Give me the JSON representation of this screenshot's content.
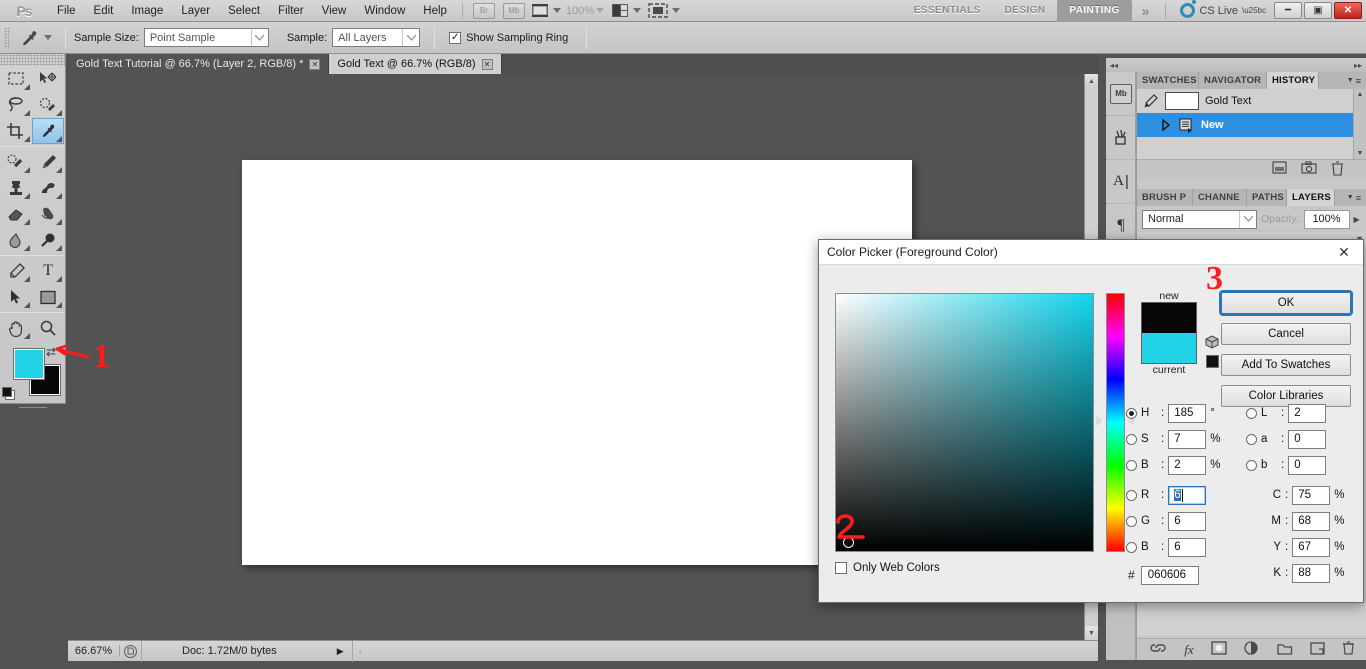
{
  "app": {
    "logo": "Ps",
    "menus": [
      "File",
      "Edit",
      "Image",
      "Layer",
      "Select",
      "Filter",
      "View",
      "Window",
      "Help"
    ],
    "bridge_button": "Br",
    "minibridge_button": "Mb",
    "zoom_level_menubar": "100%",
    "workspaces": [
      "ESSENTIALS",
      "DESIGN",
      "PAINTING"
    ],
    "workspace_active": "PAINTING",
    "workspace_more": "»",
    "cs_live": "CS Live",
    "window_buttons": {
      "minimize": "━",
      "restore": "▣",
      "close": "✕"
    }
  },
  "options_bar": {
    "tool": "eyedropper-tool",
    "sample_size_label": "Sample Size:",
    "sample_size_value": "Point Sample",
    "sample_label": "Sample:",
    "sample_value": "All Layers",
    "show_sampling_ring_label": "Show Sampling Ring",
    "show_sampling_ring_checked": true,
    "checkmark": "✓"
  },
  "document_tabs": [
    {
      "label": "Gold Text Tutorial @ 66.7% (Layer 2, RGB/8) *",
      "active": false,
      "close": "✕"
    },
    {
      "label": "Gold Text @ 66.7% (RGB/8)",
      "active": true,
      "close": "✕"
    }
  ],
  "toolbar": {
    "tools": [
      {
        "name": "rectangular-marquee-tool",
        "glyph": "⬚"
      },
      {
        "name": "move-tool",
        "glyph": "✥"
      },
      {
        "name": "lasso-tool",
        "glyph": "❦"
      },
      {
        "name": "quick-selection-tool",
        "glyph": "✒"
      },
      {
        "name": "crop-tool",
        "glyph": "⌗"
      },
      {
        "name": "eyedropper-tool",
        "glyph": "✐",
        "selected": true
      },
      {
        "name": "spot-healing-brush-tool",
        "glyph": "☙"
      },
      {
        "name": "brush-tool",
        "glyph": "✏"
      },
      {
        "name": "clone-stamp-tool",
        "glyph": "☖"
      },
      {
        "name": "history-brush-tool",
        "glyph": "✍"
      },
      {
        "name": "eraser-tool",
        "glyph": "▱"
      },
      {
        "name": "gradient-tool",
        "glyph": "◩"
      },
      {
        "name": "blur-tool",
        "glyph": "◖"
      },
      {
        "name": "dodge-tool",
        "glyph": "⚫"
      },
      {
        "name": "pen-tool",
        "glyph": "✑"
      },
      {
        "name": "horizontal-type-tool",
        "glyph": "T"
      },
      {
        "name": "path-selection-tool",
        "glyph": "➤"
      },
      {
        "name": "rectangle-tool",
        "glyph": "■"
      },
      {
        "name": "hand-tool",
        "glyph": "✋"
      },
      {
        "name": "zoom-tool",
        "glyph": "⌕"
      }
    ],
    "foreground_color": "#22d3e8",
    "background_color": "#060606",
    "swap_glyph": "⇄"
  },
  "status_bar": {
    "zoom": "66.67%",
    "doc_info": "Doc: 1.72M/0 bytes",
    "arrow": "▶",
    "left_arrow": "‹"
  },
  "history_panel": {
    "tabs": [
      "SWATCHES",
      "NAVIGATOR",
      "HISTORY"
    ],
    "active_tab": "HISTORY",
    "menu_glyph": "≡",
    "states": [
      {
        "label": "Gold Text",
        "selected": false
      },
      {
        "label": "New",
        "selected": true
      }
    ],
    "footer_icons": [
      "new-document-from-state-icon",
      "new-snapshot-icon",
      "delete-state-icon"
    ],
    "selected_color": "#2e8fe0"
  },
  "layers_panel": {
    "tabs": [
      "BRUSH P",
      "CHANNE",
      "PATHS",
      "LAYERS"
    ],
    "active_tab": "LAYERS",
    "menu_glyph": "≡",
    "blend_mode": "Normal",
    "opacity_label": "Opacity:",
    "opacity_value": "100%",
    "footer_icons": [
      "link-layers-icon",
      "layer-style-icon",
      "layer-mask-icon",
      "adjustment-layer-icon",
      "new-group-icon",
      "new-layer-icon",
      "delete-layer-icon"
    ]
  },
  "icon_rail": {
    "items": [
      "mini-bridge-icon",
      "brush-presets-icon",
      "character-icon",
      "paragraph-icon"
    ],
    "labels": [
      "Mb",
      "✁",
      "A",
      "¶"
    ],
    "collapse_left": "◂◂",
    "collapse_right": "▸▸"
  },
  "color_picker": {
    "title": "Color Picker (Foreground Color)",
    "close_glyph": "✕",
    "buttons": {
      "ok": "OK",
      "cancel": "Cancel",
      "add_to_swatches": "Add To Swatches",
      "color_libraries": "Color Libraries"
    },
    "preview": {
      "new_label": "new",
      "current_label": "current",
      "new_color": "#060606",
      "current_color": "#22d3e8"
    },
    "only_web_colors_label": "Only Web Colors",
    "only_web_colors_checked": false,
    "hsb": [
      {
        "key": "H",
        "value": "185",
        "unit": "°",
        "selected": true
      },
      {
        "key": "S",
        "value": "7",
        "unit": "%",
        "selected": false
      },
      {
        "key": "B",
        "value": "2",
        "unit": "%",
        "selected": false
      }
    ],
    "rgb": [
      {
        "key": "R",
        "value": "6",
        "unit": "",
        "selected": false,
        "focused": true
      },
      {
        "key": "G",
        "value": "6",
        "unit": "",
        "selected": false
      },
      {
        "key": "B",
        "value": "6",
        "unit": "",
        "selected": false
      }
    ],
    "lab": [
      {
        "key": "L",
        "value": "2",
        "unit": "",
        "selected": false
      },
      {
        "key": "a",
        "value": "0",
        "unit": "",
        "selected": false
      },
      {
        "key": "b",
        "value": "0",
        "unit": "",
        "selected": false
      }
    ],
    "cmyk": [
      {
        "key": "C",
        "value": "75",
        "unit": "%"
      },
      {
        "key": "M",
        "value": "68",
        "unit": "%"
      },
      {
        "key": "Y",
        "value": "67",
        "unit": "%"
      },
      {
        "key": "K",
        "value": "88",
        "unit": "%"
      }
    ],
    "hex_label": "#",
    "hex_value": "060606",
    "field_hue_color": "#14d4ec"
  },
  "annotations": [
    {
      "label": "1",
      "target": "foreground-color-swatch"
    },
    {
      "label": "2",
      "target": "color-field-cursor"
    },
    {
      "label": "3",
      "target": "ok-button"
    }
  ]
}
